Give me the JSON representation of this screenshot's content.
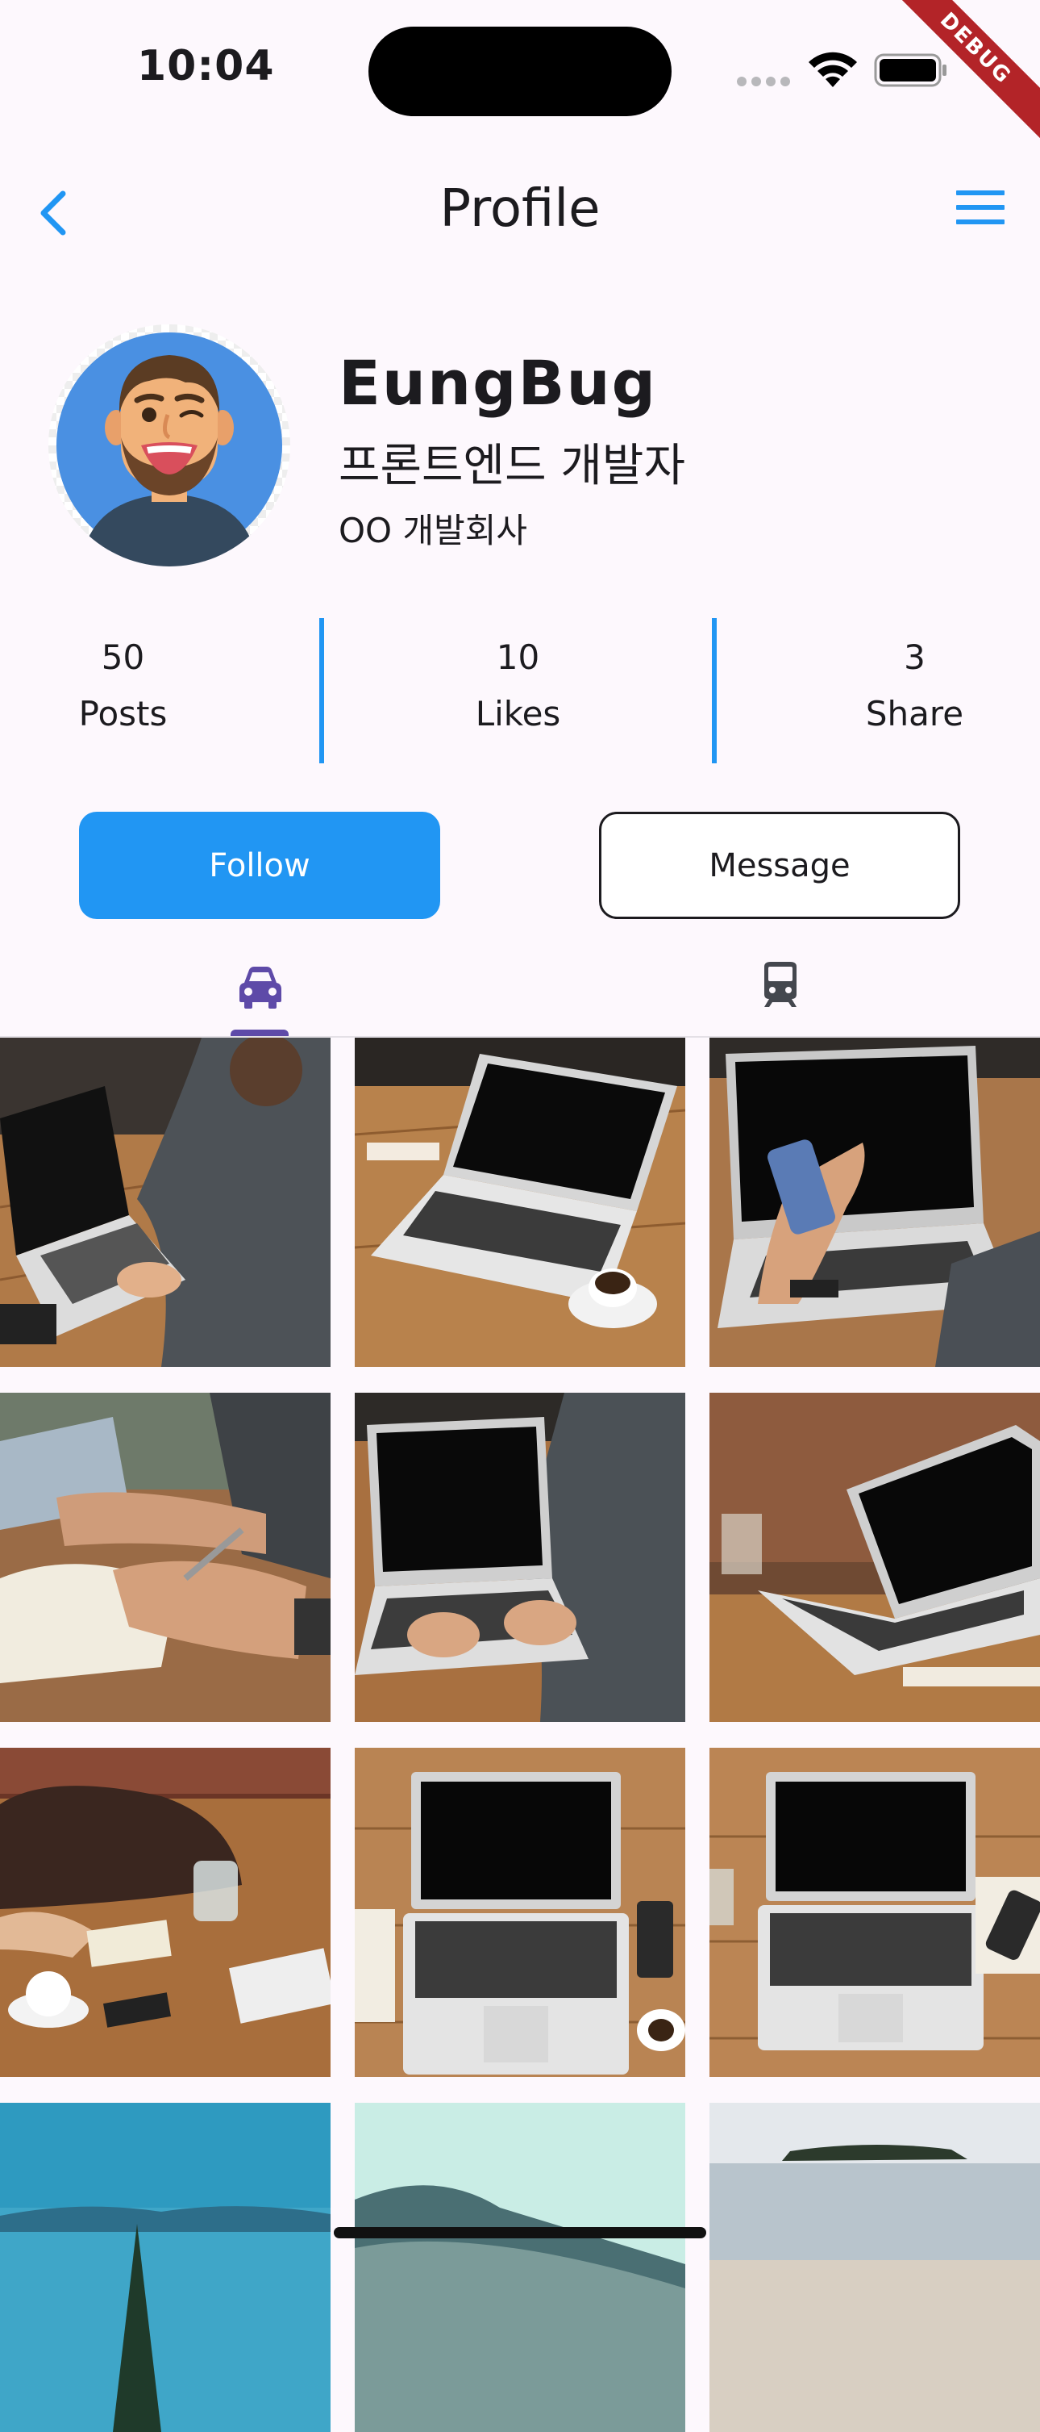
{
  "status_bar": {
    "time": "10:04",
    "debug_label": "DEBUG"
  },
  "app_bar": {
    "title": "Profile",
    "back_icon": "chevron-left-icon",
    "menu_icon": "menu-icon"
  },
  "profile": {
    "name": "EungBug",
    "job": "프론트엔드 개발자",
    "company": "OO 개발회사"
  },
  "stats": [
    {
      "value": "50",
      "label": "Posts"
    },
    {
      "value": "10",
      "label": "Likes"
    },
    {
      "value": "3",
      "label": "Share"
    }
  ],
  "actions": {
    "follow_label": "Follow",
    "message_label": "Message"
  },
  "tabs": [
    {
      "icon": "car-icon",
      "selected": true
    },
    {
      "icon": "train-icon",
      "selected": false
    }
  ],
  "colors": {
    "accent": "#2196f3",
    "tab_indicator": "#5e4aa8",
    "background": "#fdf8fd"
  }
}
